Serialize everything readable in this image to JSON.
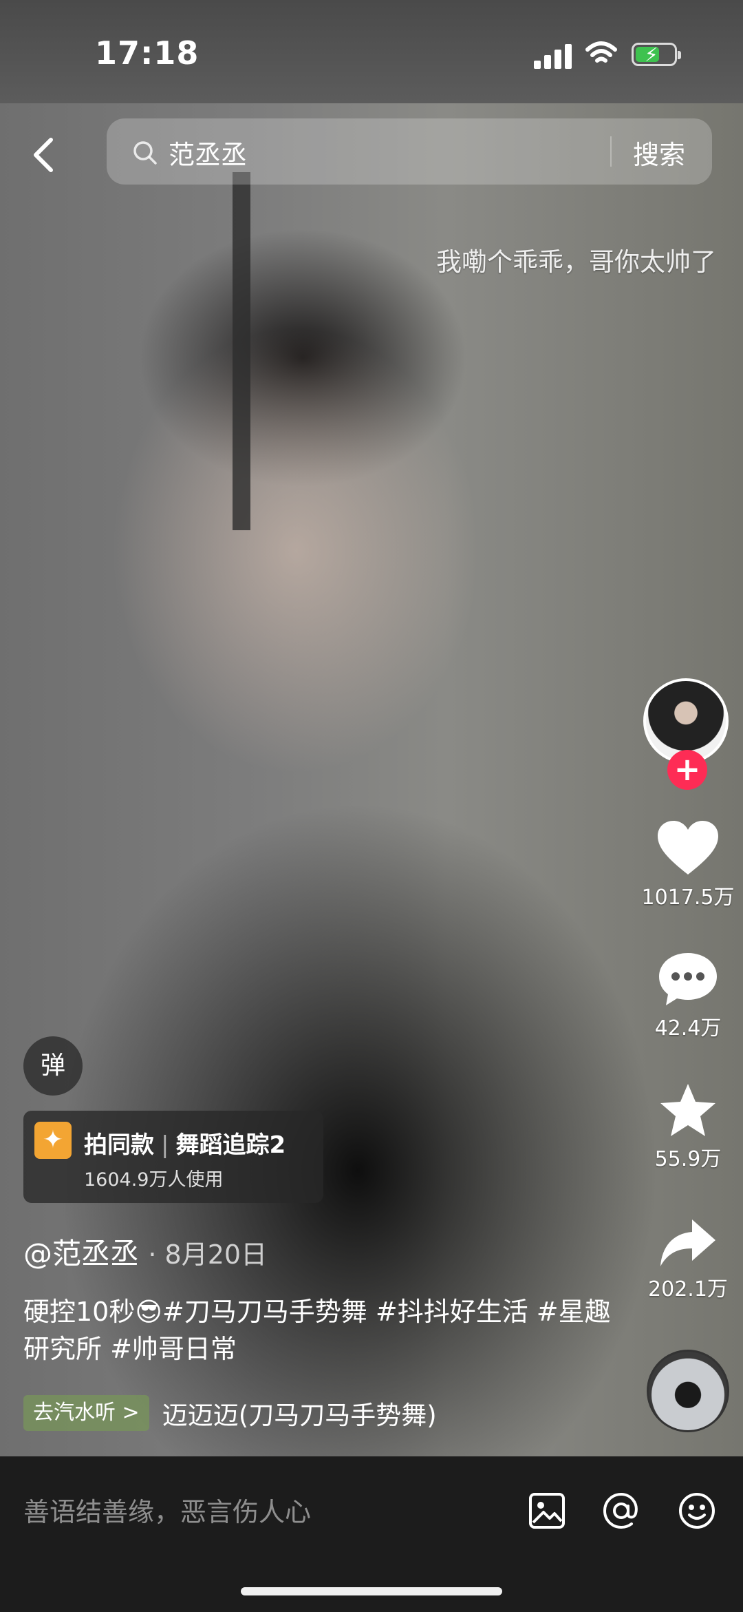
{
  "status_bar": {
    "time": "17:18"
  },
  "search": {
    "query": "范丞丞",
    "button_label": "搜索"
  },
  "danmu_text": "我嘞个乖乖，哥你太帅了",
  "actions": {
    "likes": "1017.5万",
    "comments": "42.4万",
    "favorites": "55.9万",
    "shares": "202.1万"
  },
  "danmu_toggle_label": "弹",
  "effect": {
    "label": "拍同款",
    "name": "舞蹈追踪2",
    "users": "1604.9万人使用"
  },
  "author": {
    "handle": "@范丞丞",
    "date": "· 8月20日"
  },
  "caption": "硬控10秒😎#刀马刀马手势舞 #抖抖好生活 #星趣研究所 #帅哥日常",
  "music": {
    "tag": "去汽水听 >",
    "title": "迈迈迈(刀马刀马手势舞)"
  },
  "comment_placeholder": "善语结善缘，恶言伤人心",
  "colors": {
    "follow_red": "#fe2c55",
    "battery_green": "#3ec24f"
  },
  "icons": [
    "back-icon",
    "search-icon",
    "heart-icon",
    "comment-icon",
    "star-icon",
    "share-icon",
    "image-icon",
    "at-icon",
    "emoji-icon"
  ]
}
